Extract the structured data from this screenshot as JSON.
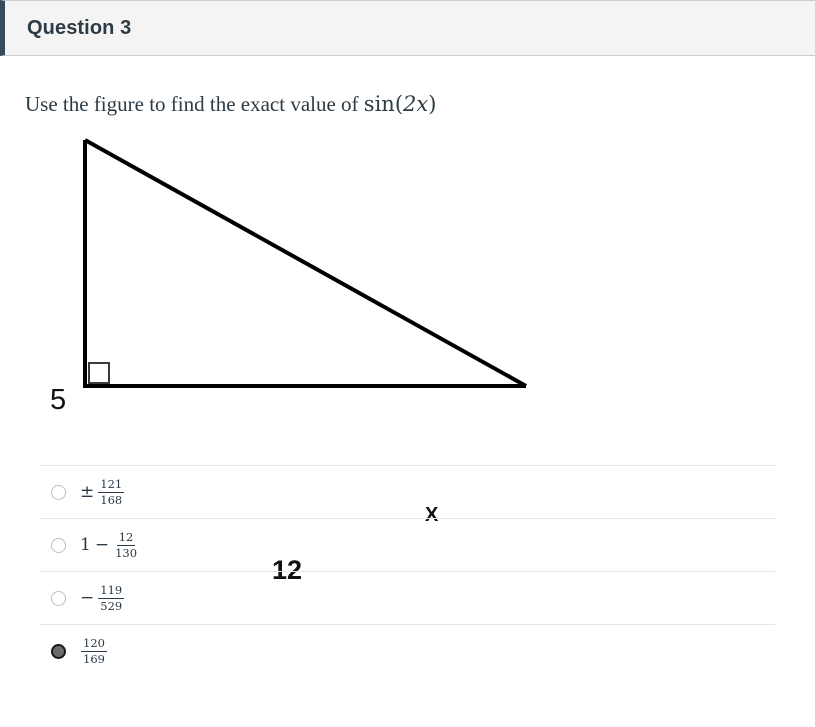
{
  "header": {
    "title": "Question 3",
    "accent_color": "#394b58",
    "background_color": "#f4f4f4"
  },
  "question": {
    "prompt_text": "Use the figure to find the exact value of ",
    "math_expression": "sin(2x)",
    "math_function": "sin",
    "math_open_paren": "(",
    "math_coefficient": "2",
    "math_variable": "x",
    "math_close_paren": ")"
  },
  "figure": {
    "type": "right-triangle",
    "vertical_leg_label": "5",
    "horizontal_leg_label": "12",
    "angle_label": "X",
    "right_angle_marker": true,
    "stroke_color": "#000000"
  },
  "answers": {
    "options": [
      {
        "id": "option-a",
        "selected": false,
        "operator": "±",
        "leading": "",
        "numerator": "121",
        "denominator": "168",
        "text": "± 121/168"
      },
      {
        "id": "option-b",
        "selected": false,
        "operator": "−",
        "leading": "1",
        "numerator": "12",
        "denominator": "130",
        "text": "1 − 12/130"
      },
      {
        "id": "option-c",
        "selected": false,
        "operator": "−",
        "leading": "",
        "numerator": "119",
        "denominator": "529",
        "text": "− 119/529"
      },
      {
        "id": "option-d",
        "selected": true,
        "operator": "",
        "leading": "",
        "numerator": "120",
        "denominator": "169",
        "text": "120/169"
      }
    ]
  }
}
